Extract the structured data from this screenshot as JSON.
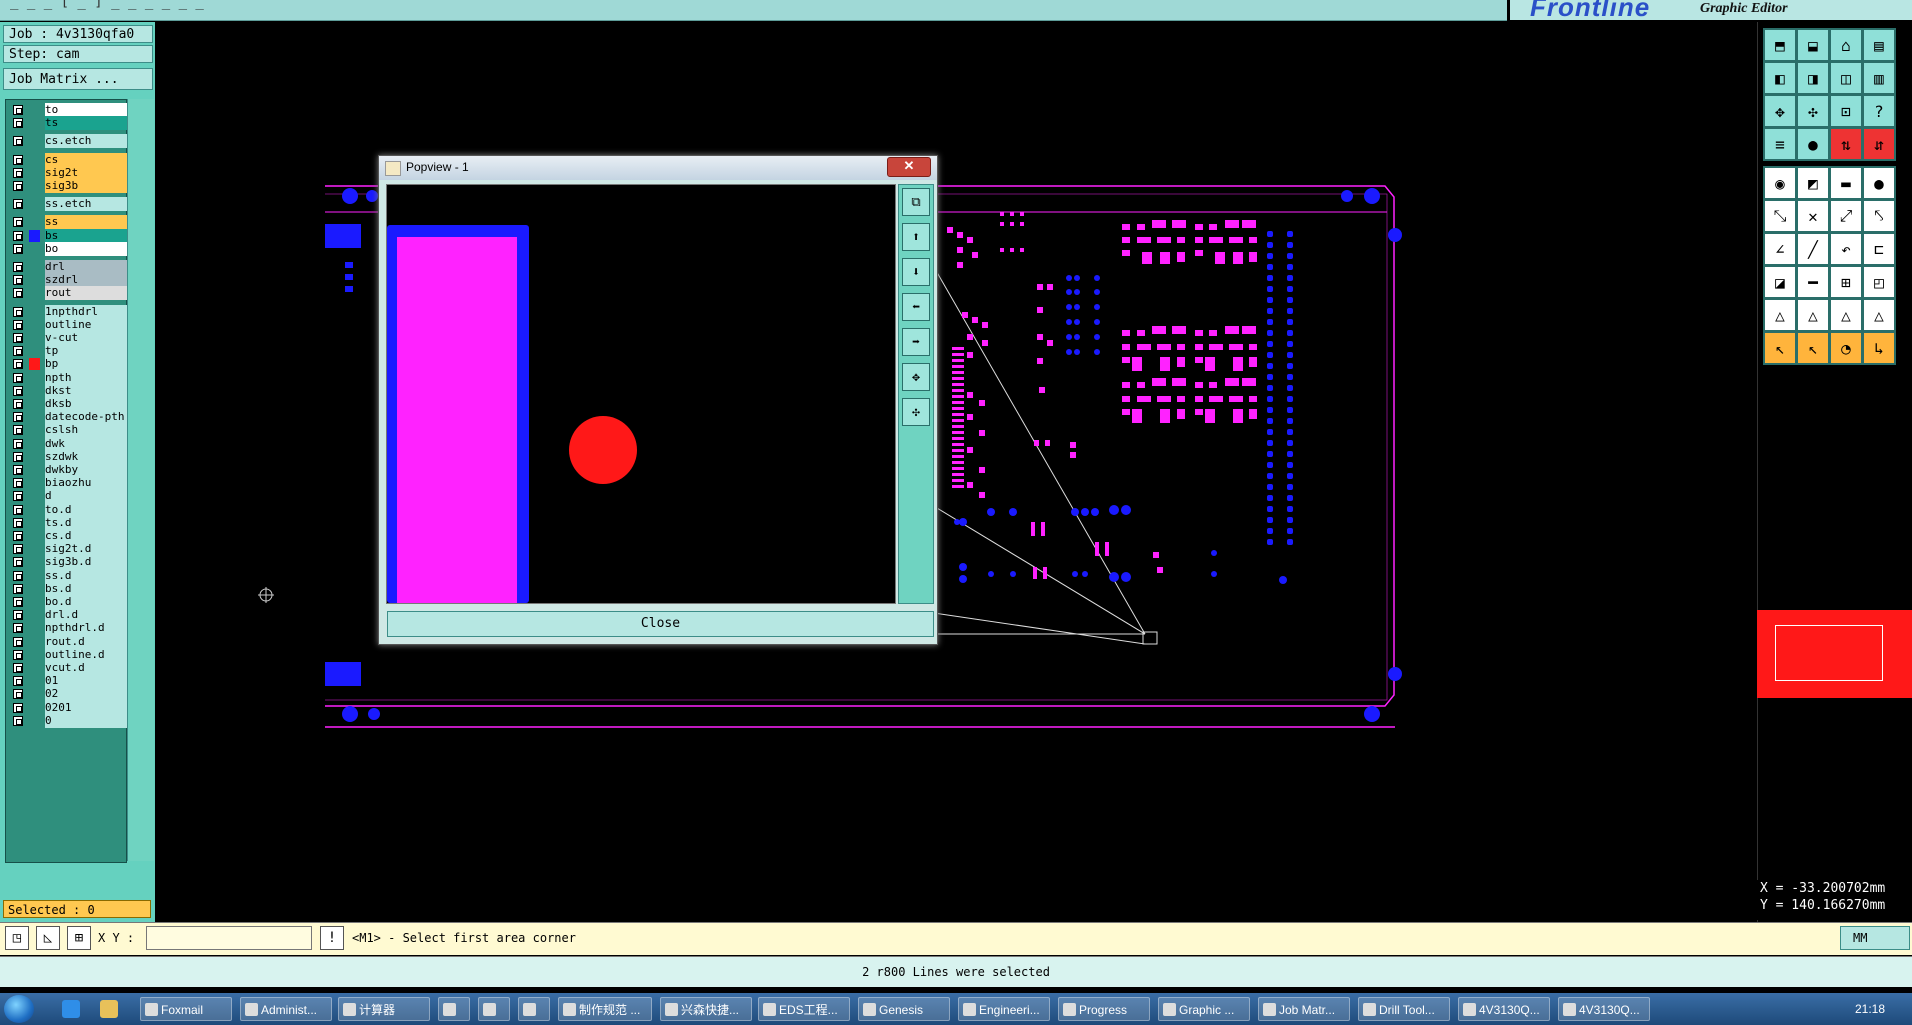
{
  "title_strip": {
    "menu": "_  _  _  [  _  ]  _  _  _  _  _  _"
  },
  "logo": {
    "brand": "Frontline",
    "subtitle": "Graphic Editor"
  },
  "job": {
    "job_line": "Job : 4v3130qfa0",
    "step_line": "Step: cam",
    "matrix_button": "Job Matrix ..."
  },
  "layers": [
    {
      "name": "to",
      "color": "#ffffff"
    },
    {
      "name": "ts",
      "color": "#1aa38f"
    },
    {
      "name": "cs.etch",
      "color": "#b6e7e2"
    },
    {
      "name": "cs",
      "color": "#ffc850"
    },
    {
      "name": "sig2t",
      "color": "#ffc850"
    },
    {
      "name": "sig3b",
      "color": "#ffc850"
    },
    {
      "name": "ss.etch",
      "color": "#b6e7e2"
    },
    {
      "name": "ss",
      "color": "#ffc850"
    },
    {
      "name": "bs",
      "color": "#1aa38f"
    },
    {
      "name": "bo",
      "color": "#ffffff"
    },
    {
      "name": "drl",
      "color": "#a9bcc4"
    },
    {
      "name": "szdrl",
      "color": "#a9bcc4"
    },
    {
      "name": "rout",
      "color": "#dddddd"
    },
    {
      "name": "1npthdrl",
      "color": "#b6e7e2"
    },
    {
      "name": "outline",
      "color": "#b6e7e2"
    },
    {
      "name": "v-cut",
      "color": "#b6e7e2"
    },
    {
      "name": "tp",
      "color": "#b6e7e2"
    },
    {
      "name": "bp",
      "color": "#b6e7e2"
    },
    {
      "name": "npth",
      "color": "#b6e7e2"
    },
    {
      "name": "dkst",
      "color": "#b6e7e2"
    },
    {
      "name": "dksb",
      "color": "#b6e7e2"
    },
    {
      "name": "datecode-pth",
      "color": "#b6e7e2"
    },
    {
      "name": "cslsh",
      "color": "#b6e7e2"
    },
    {
      "name": "dwk",
      "color": "#b6e7e2"
    },
    {
      "name": "szdwk",
      "color": "#b6e7e2"
    },
    {
      "name": "dwkby",
      "color": "#b6e7e2"
    },
    {
      "name": "biaozhu",
      "color": "#b6e7e2"
    },
    {
      "name": "d",
      "color": "#b6e7e2"
    },
    {
      "name": "to.d",
      "color": "#b6e7e2"
    },
    {
      "name": "ts.d",
      "color": "#b6e7e2"
    },
    {
      "name": "cs.d",
      "color": "#b6e7e2"
    },
    {
      "name": "sig2t.d",
      "color": "#b6e7e2"
    },
    {
      "name": "sig3b.d",
      "color": "#b6e7e2"
    },
    {
      "name": "ss.d",
      "color": "#b6e7e2"
    },
    {
      "name": "bs.d",
      "color": "#b6e7e2"
    },
    {
      "name": "bo.d",
      "color": "#b6e7e2"
    },
    {
      "name": "drl.d",
      "color": "#b6e7e2"
    },
    {
      "name": "npthdrl.d",
      "color": "#b6e7e2"
    },
    {
      "name": "rout.d",
      "color": "#b6e7e2"
    },
    {
      "name": "outline.d",
      "color": "#b6e7e2"
    },
    {
      "name": "vcut.d",
      "color": "#b6e7e2"
    },
    {
      "name": "01",
      "color": "#b6e7e2"
    },
    {
      "name": "02",
      "color": "#b6e7e2"
    },
    {
      "name": "0201",
      "color": "#b6e7e2"
    },
    {
      "name": "0",
      "color": "#b6e7e2"
    }
  ],
  "selected": "Selected : 0",
  "popview": {
    "title": "Popview - 1",
    "close_x": "✕",
    "close_button": "Close"
  },
  "coords": {
    "x_line": "X = -33.200702mm",
    "y_line": "Y = 140.166270mm"
  },
  "command": {
    "xy_label": "X Y :",
    "xy_value": "",
    "prompt": "<M1> - Select first area corner",
    "units": "MM"
  },
  "status": "2 r800 Lines were selected",
  "colors": {
    "active_layer": "#ff1818",
    "pad": "#ff22ff",
    "via": "#1a1aff",
    "outline": "#ff22ff"
  },
  "taskbar": {
    "tasks": [
      "Foxmail",
      "Administ...",
      "计算器",
      "",
      "",
      "",
      "制作规范 ...",
      "兴森快捷...",
      "EDS工程...",
      "Genesis",
      "Engineeri...",
      "Progress",
      "Graphic ...",
      "Job Matr...",
      "Drill Tool...",
      "4V3130Q...",
      "4V3130Q..."
    ],
    "clock": "21:18"
  }
}
